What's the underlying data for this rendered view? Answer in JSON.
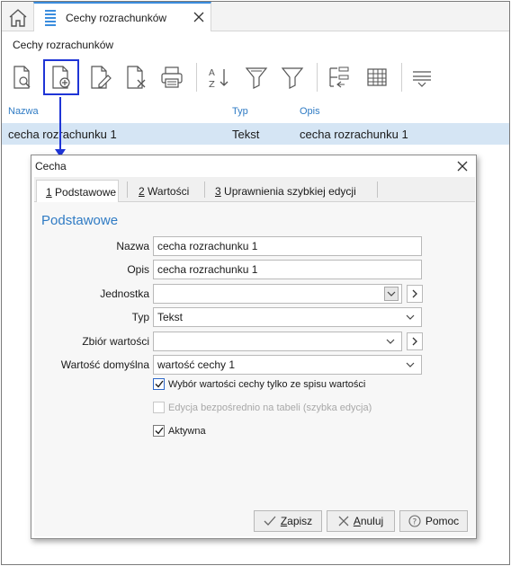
{
  "tab": {
    "label": "Cechy rozrachunków"
  },
  "page": {
    "title": "Cechy rozrachunków"
  },
  "toolbar": {
    "buttons": [
      "preview",
      "add",
      "edit",
      "delete",
      "print",
      "sort",
      "filter-advanced",
      "filter",
      "group",
      "columns",
      "view-options"
    ]
  },
  "grid": {
    "columns": [
      "Nazwa",
      "Typ",
      "Opis"
    ],
    "rows": [
      {
        "nazwa": "cecha rozrachunku 1",
        "typ": "Tekst",
        "opis": "cecha rozrachunku 1"
      }
    ]
  },
  "dialog": {
    "title": "Cecha",
    "tabs": [
      {
        "num": "1",
        "label": " Podstawowe"
      },
      {
        "num": "2",
        "label": " Wartości"
      },
      {
        "num": "3",
        "label": " Uprawnienia szybkiej edycji"
      }
    ],
    "section": "Podstawowe",
    "fields": {
      "nazwa": {
        "label": "Nazwa",
        "value": "cecha rozrachunku 1"
      },
      "opis": {
        "label": "Opis",
        "value": "cecha rozrachunku 1"
      },
      "jednostka": {
        "label": "Jednostka",
        "value": ""
      },
      "typ": {
        "label": "Typ",
        "value": "Tekst"
      },
      "zbior": {
        "label": "Zbiór wartości",
        "value": ""
      },
      "domyslna": {
        "label": "Wartość domyślna",
        "value": "wartość cechy 1"
      }
    },
    "checks": {
      "wybor": {
        "label": "Wybór wartości cechy tylko ze spisu wartości",
        "checked": true
      },
      "edycja": {
        "label": "Edycja bezpośrednio na tabeli (szybka edycja)",
        "checked": false
      },
      "aktywna": {
        "label": "Aktywna",
        "checked": true
      }
    },
    "buttons": {
      "zapisz": {
        "ul": "Z",
        "rest": "apisz"
      },
      "anuluj": {
        "ul": "A",
        "rest": "nuluj"
      },
      "pomoc": {
        "label": "Pomoc"
      }
    }
  },
  "colors": {
    "accent": "#2f7bc4",
    "highlight": "#1f35d6",
    "selected_row": "#d5e5f4"
  }
}
